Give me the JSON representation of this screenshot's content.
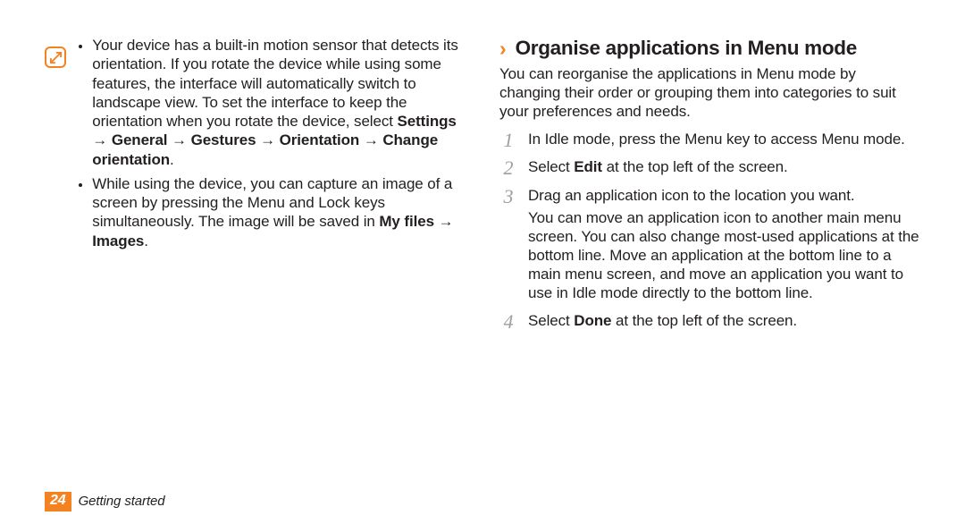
{
  "note": {
    "bullets": [
      {
        "pre": "Your device has a built-in motion sensor that detects its orientation. If you rotate the device while using some features, the interface will automatically switch to landscape view. To set the interface to keep the orientation when you rotate the device, select ",
        "bold": "Settings → General → Gestures → Orientation → Change orientation",
        "post": "."
      },
      {
        "pre": "While using the device, you can capture an image of a screen by pressing the Menu and Lock keys simultaneously. The image will be saved in ",
        "bold": "My files → Images",
        "post": "."
      }
    ]
  },
  "heading": {
    "chevron": "›",
    "text": "Organise applications in Menu mode"
  },
  "intro": "You can reorganise the applications in Menu mode by changing their order or grouping them into categories to suit your preferences and needs.",
  "steps": [
    {
      "num": "1",
      "parts": [
        {
          "t": "In Idle mode, press the Menu key to access Menu mode."
        }
      ]
    },
    {
      "num": "2",
      "parts": [
        {
          "t": "Select "
        },
        {
          "t": "Edit",
          "b": true
        },
        {
          "t": " at the top left of the screen."
        }
      ]
    },
    {
      "num": "3",
      "parts": [
        {
          "t": "Drag an application icon to the location you want."
        }
      ],
      "extra": "You can move an application icon to another main menu screen. You can also change most-used applications at the bottom line. Move an application at the bottom line to a main menu screen, and move an application you want to use in Idle mode directly to the bottom line."
    },
    {
      "num": "4",
      "parts": [
        {
          "t": "Select "
        },
        {
          "t": "Done",
          "b": true
        },
        {
          "t": " at the top left of the screen."
        }
      ]
    }
  ],
  "footer": {
    "page": "24",
    "chapter": "Getting started"
  }
}
